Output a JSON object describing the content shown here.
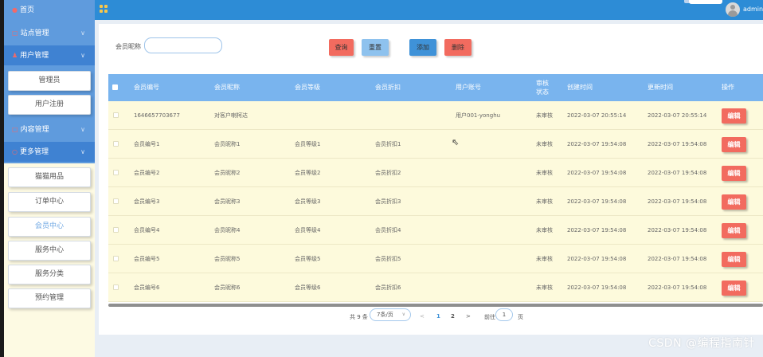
{
  "sidebar": {
    "home": "首页",
    "site_mgmt": "站点管理",
    "user_mgmt": "用户管理",
    "user_sub": [
      "管理员",
      "用户注册"
    ],
    "content_mgmt": "内容管理",
    "more_mgmt": "更多管理",
    "more_sub": [
      "猫猫用品",
      "订单中心",
      "会员中心",
      "服务中心",
      "服务分类",
      "预约管理"
    ],
    "chevron": "∨"
  },
  "header": {
    "admin": "admin"
  },
  "search": {
    "label": "会员昵称",
    "value": "",
    "query": "查询",
    "reset": "重置",
    "add": "添加",
    "delete": "删除"
  },
  "table": {
    "headers": [
      "会员编号",
      "会员昵称",
      "会员等级",
      "会员折扣",
      "用户账号",
      "审核状态",
      "创建时间",
      "更新时间",
      "操作"
    ],
    "edit_label": "编辑",
    "rows": [
      [
        "1646657703677",
        "对客户喇柯达",
        "",
        "",
        "用户001-yonghu",
        "未审核",
        "2022-03-07 20:55:14",
        "2022-03-07 20:55:14"
      ],
      [
        "会员编号1",
        "会员昵称1",
        "会员等级1",
        "会员折扣1",
        "",
        "未审核",
        "2022-03-07 19:54:08",
        "2022-03-07 19:54:08"
      ],
      [
        "会员编号2",
        "会员昵称2",
        "会员等级2",
        "会员折扣2",
        "",
        "未审核",
        "2022-03-07 19:54:08",
        "2022-03-07 19:54:08"
      ],
      [
        "会员编号3",
        "会员昵称3",
        "会员等级3",
        "会员折扣3",
        "",
        "未审核",
        "2022-03-07 19:54:08",
        "2022-03-07 19:54:08"
      ],
      [
        "会员编号4",
        "会员昵称4",
        "会员等级4",
        "会员折扣4",
        "",
        "未审核",
        "2022-03-07 19:54:08",
        "2022-03-07 19:54:08"
      ],
      [
        "会员编号5",
        "会员昵称5",
        "会员等级5",
        "会员折扣5",
        "",
        "未审核",
        "2022-03-07 19:54:08",
        "2022-03-07 19:54:08"
      ],
      [
        "会员编号6",
        "会员昵称6",
        "会员等级6",
        "会员折扣6",
        "",
        "未审核",
        "2022-03-07 19:54:08",
        "2022-03-07 19:54:08"
      ]
    ]
  },
  "pagination": {
    "total": "共 9 条",
    "page_size": "7条/页",
    "prev": "<",
    "pages": [
      "1",
      "2"
    ],
    "next": ">",
    "goto": "前往",
    "current": "1",
    "page_unit": "页"
  },
  "watermark": "CSDN @编程指南针",
  "colors": {
    "topbar": "#2d8cd6",
    "sidebar": "#5f9bdd",
    "table_header": "#79b4ee",
    "row_bg": "#fdfadc",
    "danger": "#f26b5f"
  }
}
